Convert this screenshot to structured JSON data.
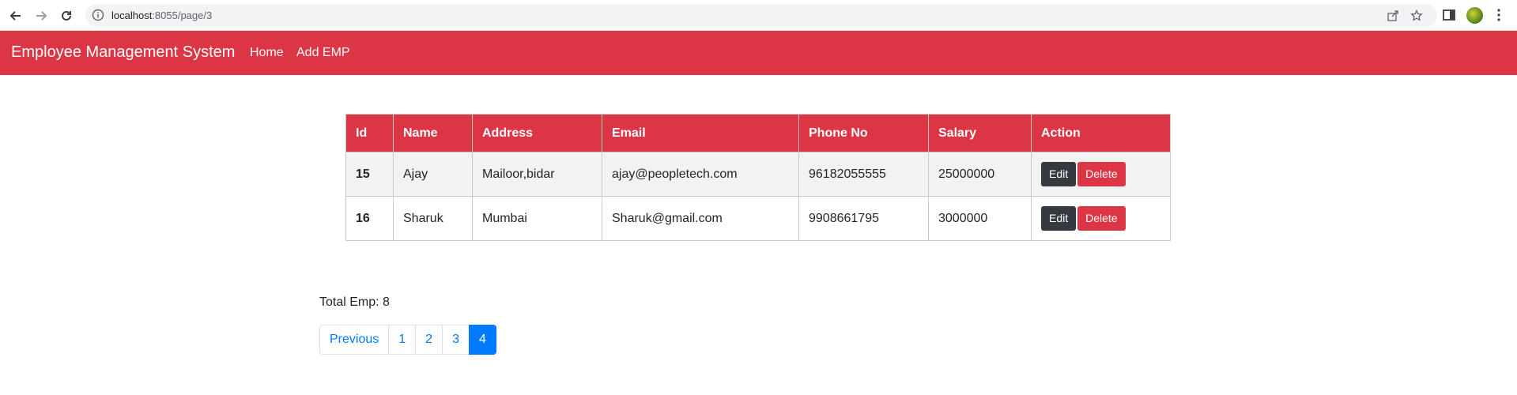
{
  "browser": {
    "url_host": "localhost",
    "url_path": ":8055/page/3"
  },
  "navbar": {
    "brand": "Employee Management System",
    "links": [
      {
        "label": "Home"
      },
      {
        "label": "Add EMP"
      }
    ],
    "color": "#dc3545"
  },
  "table": {
    "headers": [
      "Id",
      "Name",
      "Address",
      "Email",
      "Phone No",
      "Salary",
      "Action"
    ],
    "rows": [
      {
        "id": "15",
        "name": "Ajay",
        "address": "Mailoor,bidar",
        "email": "ajay@peopletech.com",
        "phone": "96182055555",
        "salary": "25000000"
      },
      {
        "id": "16",
        "name": "Sharuk",
        "address": "Mumbai",
        "email": "Sharuk@gmail.com",
        "phone": "9908661795",
        "salary": "3000000"
      }
    ],
    "edit_label": "Edit",
    "delete_label": "Delete"
  },
  "total_text": "Total Emp: 8",
  "pagination": {
    "previous": "Previous",
    "pages": [
      "1",
      "2",
      "3",
      "4"
    ],
    "active_page": "4"
  }
}
